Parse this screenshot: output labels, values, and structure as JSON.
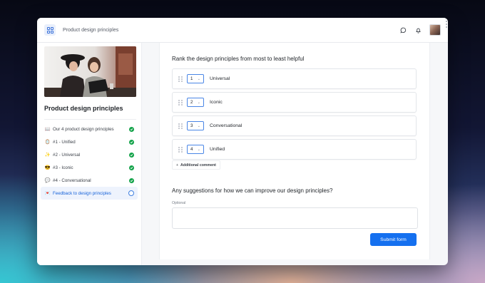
{
  "header": {
    "title": "Product design principles"
  },
  "sidebar": {
    "title": "Product design principles",
    "items": [
      {
        "emoji": "📖",
        "label": "Our 4 product design principles",
        "status": "complete"
      },
      {
        "emoji": "🪞",
        "label": "#1 - Unified",
        "status": "complete"
      },
      {
        "emoji": "✨",
        "label": "#2 - Universal",
        "status": "complete"
      },
      {
        "emoji": "😎",
        "label": "#3 - Iconic",
        "status": "complete"
      },
      {
        "emoji": "💬",
        "label": "#4 - Conversational",
        "status": "complete"
      },
      {
        "emoji": "💌",
        "label": "Feedback to design principles",
        "status": "current"
      }
    ]
  },
  "form": {
    "rank_question": "Rank the design principles from most to least helpful",
    "rank_items": [
      {
        "rank": "1",
        "label": "Universal"
      },
      {
        "rank": "2",
        "label": "Iconic"
      },
      {
        "rank": "3",
        "label": "Conversational"
      },
      {
        "rank": "4",
        "label": "Unified"
      }
    ],
    "add_comment_label": "Additional comment",
    "suggestion_question": "Any suggestions for how we can improve our design principles?",
    "optional_label": "Optional",
    "textarea_value": "",
    "submit_label": "Submit form"
  },
  "colors": {
    "accent": "#1570ef",
    "complete": "#14a34a",
    "active_bg": "#eef3fd"
  }
}
